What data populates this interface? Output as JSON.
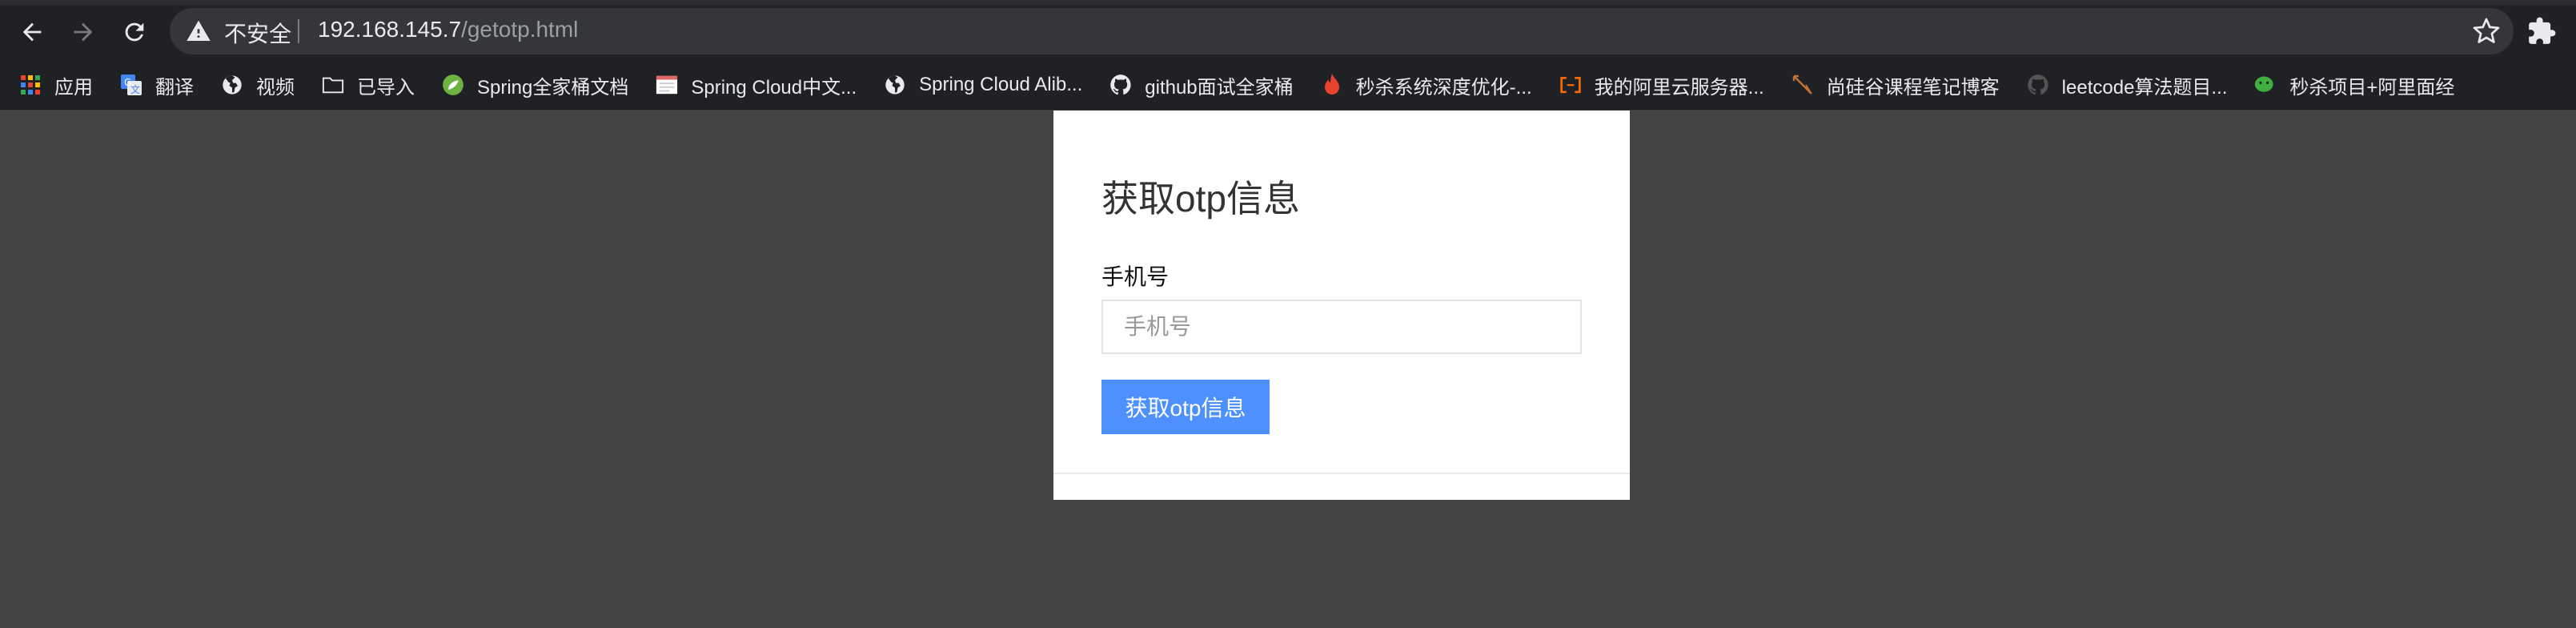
{
  "browser": {
    "security_label": "不安全",
    "url_host": "192.168.145.7",
    "url_path": "/getotp.html",
    "icons": {
      "back": "arrow-left-icon",
      "forward": "arrow-right-icon",
      "reload": "reload-icon",
      "warning": "warning-triangle-icon",
      "bookmark_star": "star-icon",
      "extensions": "puzzle-icon"
    }
  },
  "bookmarks": [
    {
      "label": "应用",
      "icon": "apps-grid-icon"
    },
    {
      "label": "翻译",
      "icon": "translate-icon"
    },
    {
      "label": "视频",
      "icon": "globe-icon"
    },
    {
      "label": "已导入",
      "icon": "folder-icon"
    },
    {
      "label": "Spring全家桶文档",
      "icon": "spring-leaf-icon"
    },
    {
      "label": "Spring Cloud中文...",
      "icon": "doc-icon"
    },
    {
      "label": "Spring Cloud Alib...",
      "icon": "globe-icon"
    },
    {
      "label": "github面试全家桶",
      "icon": "github-icon"
    },
    {
      "label": "秒杀系统深度优化-...",
      "icon": "flame-icon"
    },
    {
      "label": "我的阿里云服务器...",
      "icon": "aliyun-icon"
    },
    {
      "label": "尚硅谷课程笔记博客",
      "icon": "pen-icon"
    },
    {
      "label": "leetcode算法题目...",
      "icon": "github-icon"
    },
    {
      "label": "秒杀项目+阿里面经",
      "icon": "wechat-icon"
    }
  ],
  "page": {
    "title": "获取otp信息",
    "field_label": "手机号",
    "input_placeholder": "手机号",
    "input_value": "",
    "submit_label": "获取otp信息"
  },
  "colors": {
    "page_background": "#444444",
    "browser_chrome": "#202124",
    "omnibox": "#35363a",
    "button_primary": "#4d90fe"
  }
}
